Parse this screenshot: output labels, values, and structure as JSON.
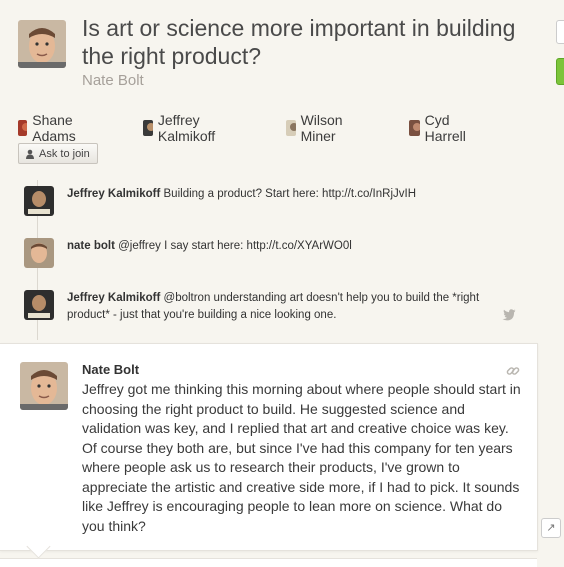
{
  "question": {
    "title": "Is art or science more important in building the right product?",
    "author": "Nate Bolt"
  },
  "participants": [
    {
      "name": "Shane Adams"
    },
    {
      "name": "Jeffrey Kalmikoff"
    },
    {
      "name": "Wilson Miner"
    },
    {
      "name": "Cyd Harrell"
    }
  ],
  "ask_to_join_label": "Ask to join",
  "tweets": [
    {
      "author": "Jeffrey Kalmikoff",
      "text": "Building a product? Start here: http://t.co/InRjJvIH"
    },
    {
      "author": "nate bolt",
      "text": "@jeffrey I say start here: http://t.co/XYArWO0l"
    },
    {
      "author": "Jeffrey Kalmikoff",
      "text": "@boltron understanding art doesn't help you to build the *right product* - just that you're building a nice looking one."
    }
  ],
  "post": {
    "author": "Nate Bolt",
    "body": "Jeffrey got me thinking this morning about where people should start in choosing the right product to build. He suggested science and validation was key, and I replied that art and creative choice was key. Of course they both are, but since I've had this company for ten years where people ask us to research their products, I've grown to appreciate the artistic and creative side more, if I had to pick. It sounds like Jeffrey is encouraging people to lean more on science. What do you think?"
  },
  "icons": {
    "link": "link-icon",
    "twitter": "twitter-bird-icon",
    "person": "person-icon"
  },
  "colors": {
    "background": "#f7f5ef",
    "accent_green": "#7cc43a"
  }
}
